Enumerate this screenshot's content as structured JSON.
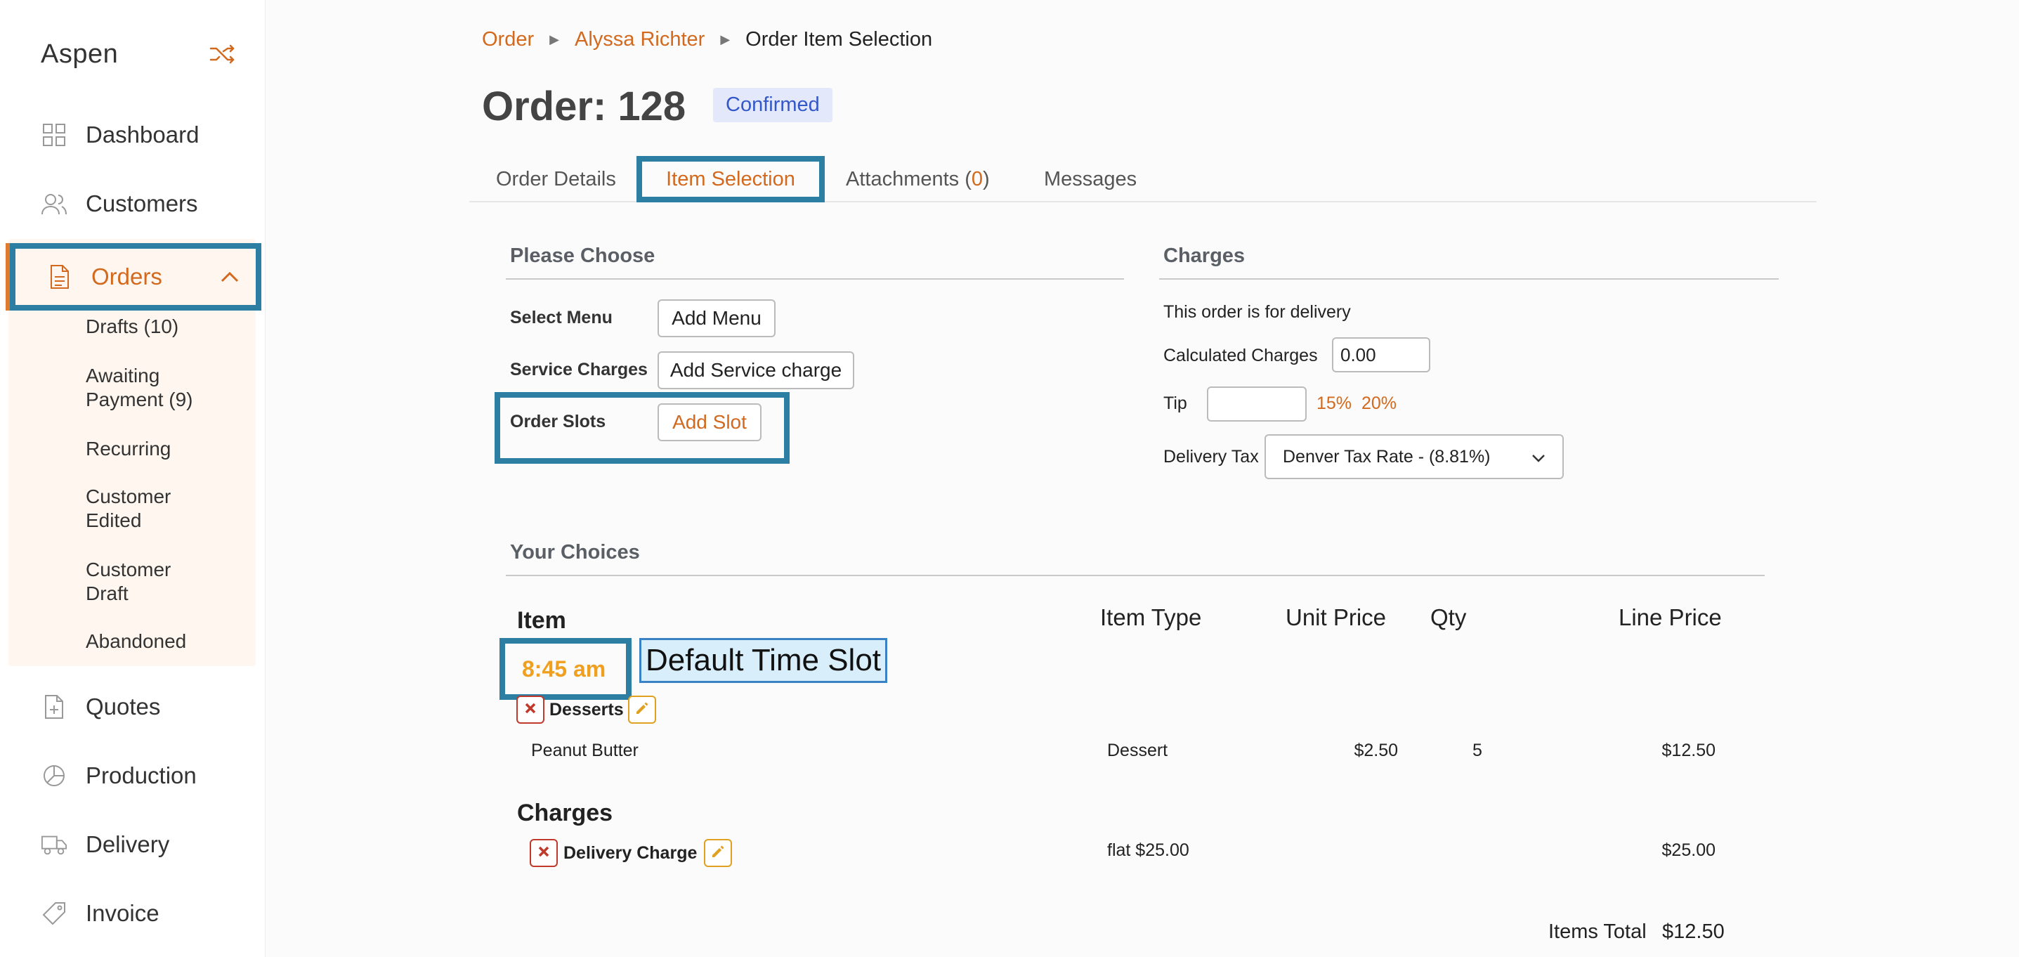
{
  "sidebar": {
    "brand": "Aspen",
    "nav": [
      {
        "label": "Dashboard",
        "icon": "grid-icon"
      },
      {
        "label": "Customers",
        "icon": "users-icon"
      },
      {
        "label": "Orders",
        "icon": "document-icon",
        "active": true
      },
      {
        "label": "Quotes",
        "icon": "file-plus-icon"
      },
      {
        "label": "Production",
        "icon": "pie-chart-icon"
      },
      {
        "label": "Delivery",
        "icon": "truck-icon"
      },
      {
        "label": "Invoice",
        "icon": "tag-icon"
      }
    ],
    "order_subitems": [
      {
        "label": "Drafts (10)"
      },
      {
        "label": "Awaiting Payment (9)"
      },
      {
        "label": "Recurring"
      },
      {
        "label": "Customer Edited"
      },
      {
        "label": "Customer Draft"
      },
      {
        "label": "Abandoned"
      }
    ]
  },
  "breadcrumb": {
    "items": [
      "Order",
      "Alyssa Richter",
      "Order Item Selection"
    ]
  },
  "order": {
    "title": "Order: 128",
    "status": "Confirmed"
  },
  "tabs": {
    "order_details": "Order Details",
    "item_selection": "Item Selection",
    "attachments_label": "Attachments (",
    "attachments_count": "0",
    "attachments_close": ")",
    "messages": "Messages"
  },
  "please_choose": {
    "heading": "Please Choose",
    "select_menu_label": "Select Menu",
    "add_menu": "Add Menu",
    "service_charges_label": "Service Charges",
    "add_service_charge": "Add Service charge",
    "order_slots_label": "Order Slots",
    "add_slot": "Add Slot"
  },
  "charges_panel": {
    "heading": "Charges",
    "delivery_note": "This order is for delivery",
    "calculated_label": "Calculated Charges",
    "calculated_value": "0.00",
    "tip_label": "Tip",
    "tip_value": "",
    "tip_15": "15%",
    "tip_20": "20%",
    "delivery_tax_label": "Delivery Tax",
    "delivery_tax_value": "Denver Tax Rate - (8.81%)"
  },
  "choices": {
    "heading": "Your Choices",
    "columns": {
      "item": "Item",
      "item_type": "Item Type",
      "unit_price": "Unit Price",
      "qty": "Qty",
      "line_price": "Line Price"
    },
    "time_slot": "8:45 am",
    "time_slot_label": "Default Time Slot",
    "group": "Desserts",
    "rows": [
      {
        "item": "Peanut Butter",
        "type": "Dessert",
        "unit_price": "$2.50",
        "qty": "5",
        "line_price": "$12.50"
      }
    ],
    "charges_heading": "Charges",
    "charge_rows": [
      {
        "name": "Delivery Charge",
        "type": "flat $25.00",
        "line_price": "$25.00"
      }
    ],
    "items_total_label": "Items Total",
    "items_total_value": "$12.50"
  },
  "colors": {
    "accent": "#d2691e",
    "highlight": "#2d7ea3",
    "slot": "#f0a020"
  }
}
